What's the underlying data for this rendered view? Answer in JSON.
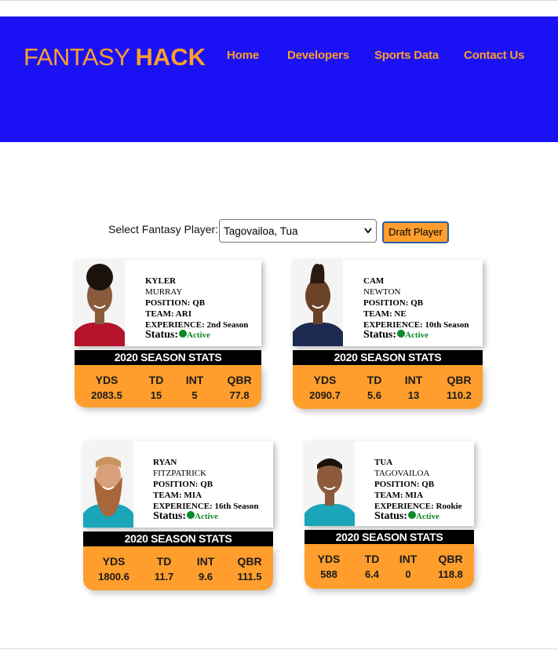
{
  "header": {
    "logo_part1": "FANTASY",
    "logo_part2": "HACK",
    "nav": [
      "Home",
      "Developers",
      "Sports Data",
      "Contact Us"
    ],
    "bg_color": "#1a12f5",
    "accent_color": "#ff9e2c"
  },
  "selector": {
    "label": "Select Fantasy Player:",
    "selected": "Tagovailoa, Tua",
    "button_label": "Draft Player"
  },
  "cards": [
    {
      "first": "KYLER",
      "last": "MURRAY",
      "position": "POSITION: QB",
      "team": "TEAM: ARI",
      "experience": "EXPERIENCE: 2nd Season",
      "status_label": "Status:",
      "status": "Active",
      "band": "2020 SEASON STATS",
      "stat_headers": [
        "YDS",
        "TD",
        "INT",
        "QBR"
      ],
      "stat_values": [
        "2083.5",
        "15",
        "5",
        "77.8"
      ],
      "jersey_color": "#b5132c"
    },
    {
      "first": "CAM",
      "last": "NEWTON",
      "position": "POSITION: QB",
      "team": "TEAM: NE",
      "experience": "EXPERIENCE: 10th Season",
      "status_label": "Status:",
      "status": "Active",
      "band": "2020 SEASON STATS",
      "stat_headers": [
        "YDS",
        "TD",
        "INT",
        "QBR"
      ],
      "stat_values": [
        "2090.7",
        "5.6",
        "13",
        "110.2"
      ],
      "jersey_color": "#1d2b52"
    },
    {
      "first": "RYAN",
      "last": "FITZPATRICK",
      "position": "POSITION: QB",
      "team": "TEAM: MIA",
      "experience": "EXPERIENCE: 16th Season",
      "status_label": "Status:",
      "status": "Active",
      "band": "2020 SEASON STATS",
      "stat_headers": [
        "YDS",
        "TD",
        "INT",
        "QBR"
      ],
      "stat_values": [
        "1800.6",
        "11.7",
        "9.6",
        "111.5"
      ],
      "jersey_color": "#1aa5b8"
    },
    {
      "first": "TUA",
      "last": "TAGOVAILOA",
      "position": "POSITION: QB",
      "team": "TEAM: MIA",
      "experience": "EXPERIENCE: Rookie",
      "status_label": "Status:",
      "status": "Active",
      "band": "2020 SEASON STATS",
      "stat_headers": [
        "YDS",
        "TD",
        "INT",
        "QBR"
      ],
      "stat_values": [
        "588",
        "6.4",
        "0",
        "118.8"
      ],
      "jersey_color": "#1aa5b8"
    }
  ]
}
